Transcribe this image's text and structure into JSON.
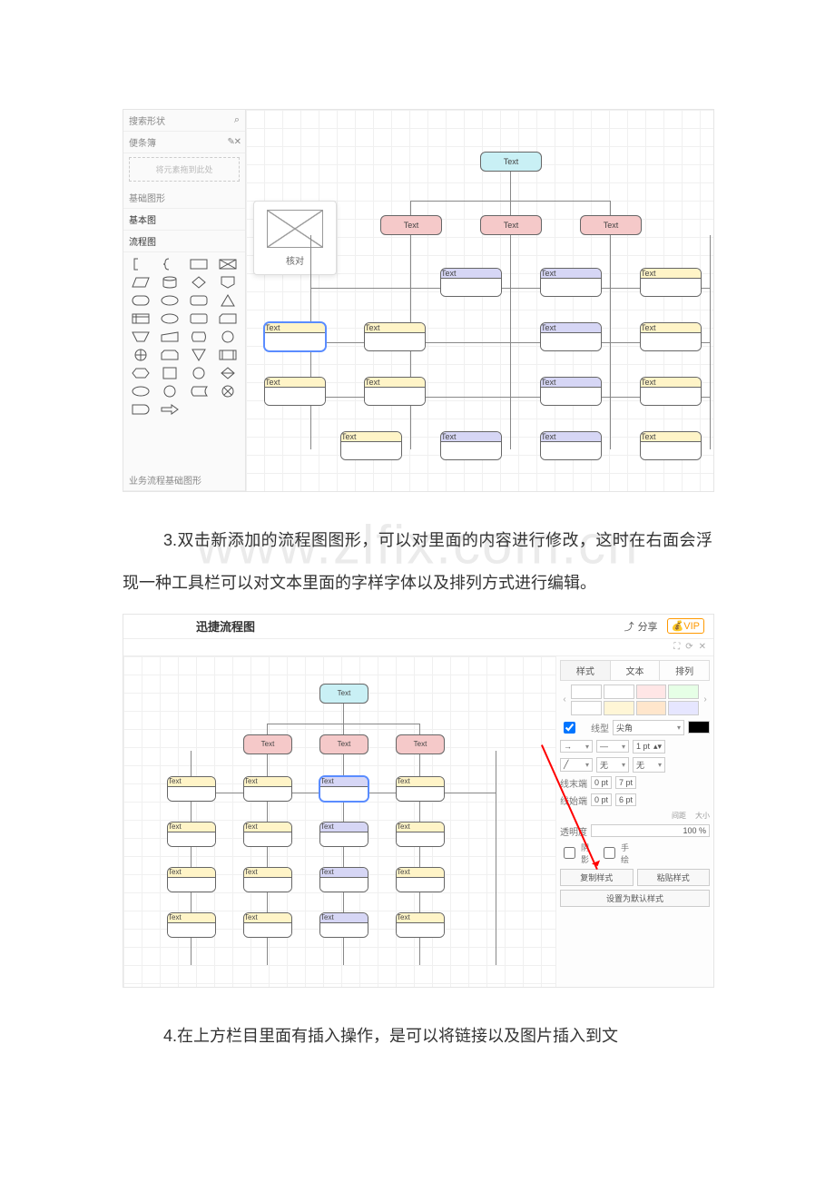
{
  "watermark": "www.zlfix.com.cn",
  "shot1": {
    "search_placeholder": "搜索形状",
    "scratchpad_label": "便条簿",
    "drop_hint": "将元素拖到此处",
    "sections": {
      "basic_shapes": "基础图形",
      "basic": "基本图",
      "flow": "流程图",
      "biz_flow": "业务流程基础图形"
    },
    "tooltip_label": "核对",
    "node_text": "Text"
  },
  "paragraph3": "3.双击新添加的流程图图形，可以对里面的内容进行修改，这时在右面会浮现一种工具栏可以对文本里面的字样字体以及排列方式进行编辑。",
  "shot2": {
    "app_title": "迅捷流程图",
    "share_label": "分享",
    "vip_label": "VIP",
    "tabs": {
      "style": "样式",
      "text": "文本",
      "arrange": "排列"
    },
    "swatches": [
      "#ffffff",
      "#ffffff",
      "#ffe6e6",
      "#e6ffe6",
      "#e6f0ff",
      "#ffffff",
      "#fff6d6",
      "#ffe6cc",
      "#f3e6ff",
      "#e6e6ff"
    ],
    "line_type_label": "线型",
    "line_type_value": "尖角",
    "line_end_label": "线末端",
    "line_start_label": "线始端",
    "spacing_label": "间距",
    "size_label": "大小",
    "opacity_label": "透明度",
    "opacity_value": "100 %",
    "shadow_label": "阴影",
    "sketch_label": "手绘",
    "copy_style": "复制样式",
    "paste_style": "粘贴样式",
    "set_default": "设置为默认样式",
    "pt1": "1 pt",
    "pt7": "7 pt",
    "pt0": "0 pt",
    "pt6": "6 pt",
    "none": "无",
    "node_text": "Text"
  },
  "paragraph4": "4.在上方栏目里面有插入操作，是可以将链接以及图片插入到文"
}
